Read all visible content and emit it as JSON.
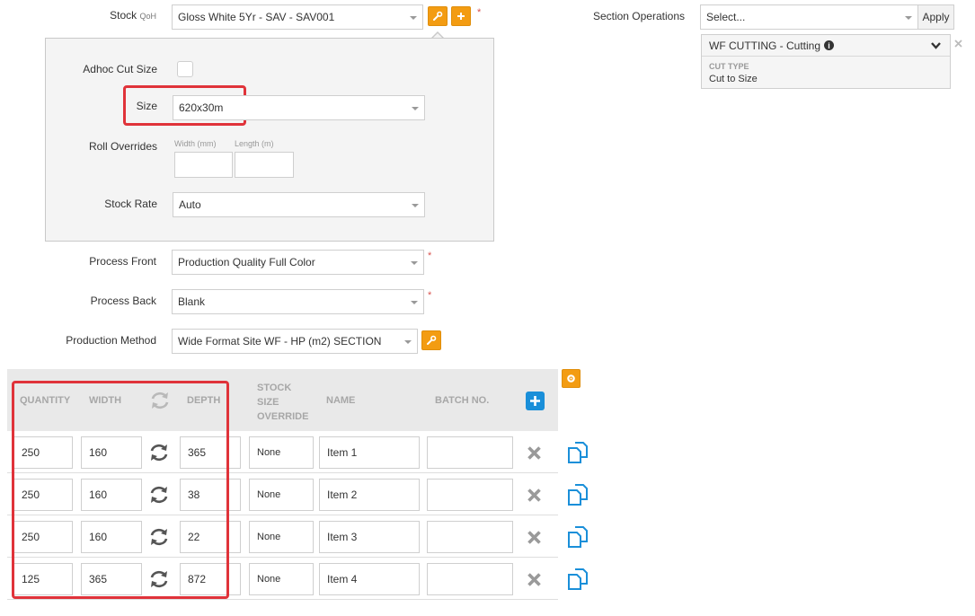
{
  "form": {
    "stock": {
      "label": "Stock",
      "sublabel": "QoH",
      "value": "Gloss White 5Yr - SAV - SAV001",
      "required": "*"
    },
    "adhoc": {
      "label": "Adhoc Cut Size"
    },
    "size": {
      "label": "Size",
      "value": "620x30m"
    },
    "roll": {
      "label": "Roll Overrides",
      "width_label": "Width (mm)",
      "length_label": "Length (m)"
    },
    "stock_rate": {
      "label": "Stock Rate",
      "value": "Auto"
    },
    "process_front": {
      "label": "Process Front",
      "value": "Production Quality Full Color",
      "required": "*"
    },
    "process_back": {
      "label": "Process Back",
      "value": "Blank",
      "required": "*"
    },
    "production_method": {
      "label": "Production Method",
      "value": "Wide Format Site WF - HP (m2) SECTION"
    }
  },
  "section_ops": {
    "label": "Section Operations",
    "select_placeholder": "Select...",
    "apply_label": "Apply",
    "card": {
      "title": "WF CUTTING - Cutting",
      "cut_type_label": "CUT TYPE",
      "cut_type_value": "Cut to Size"
    }
  },
  "table": {
    "headers": {
      "quantity": "QUANTITY",
      "width": "WIDTH",
      "depth": "DEPTH",
      "stock1": "STOCK",
      "stock2": "SIZE",
      "stock3": "OVERRIDE",
      "name": "NAME",
      "batch": "BATCH NO."
    },
    "rows": [
      {
        "quantity": "250",
        "width": "160",
        "depth": "365",
        "override": "None",
        "name": "Item 1",
        "batch": ""
      },
      {
        "quantity": "250",
        "width": "160",
        "depth": "38",
        "override": "None",
        "name": "Item 2",
        "batch": ""
      },
      {
        "quantity": "250",
        "width": "160",
        "depth": "22",
        "override": "None",
        "name": "Item 3",
        "batch": ""
      },
      {
        "quantity": "125",
        "width": "365",
        "depth": "872",
        "override": "None",
        "name": "Item 4",
        "batch": ""
      }
    ]
  },
  "colors": {
    "accent_orange": "#f39c12",
    "accent_blue": "#1a8fd9",
    "highlight_red": "#e0333a"
  }
}
